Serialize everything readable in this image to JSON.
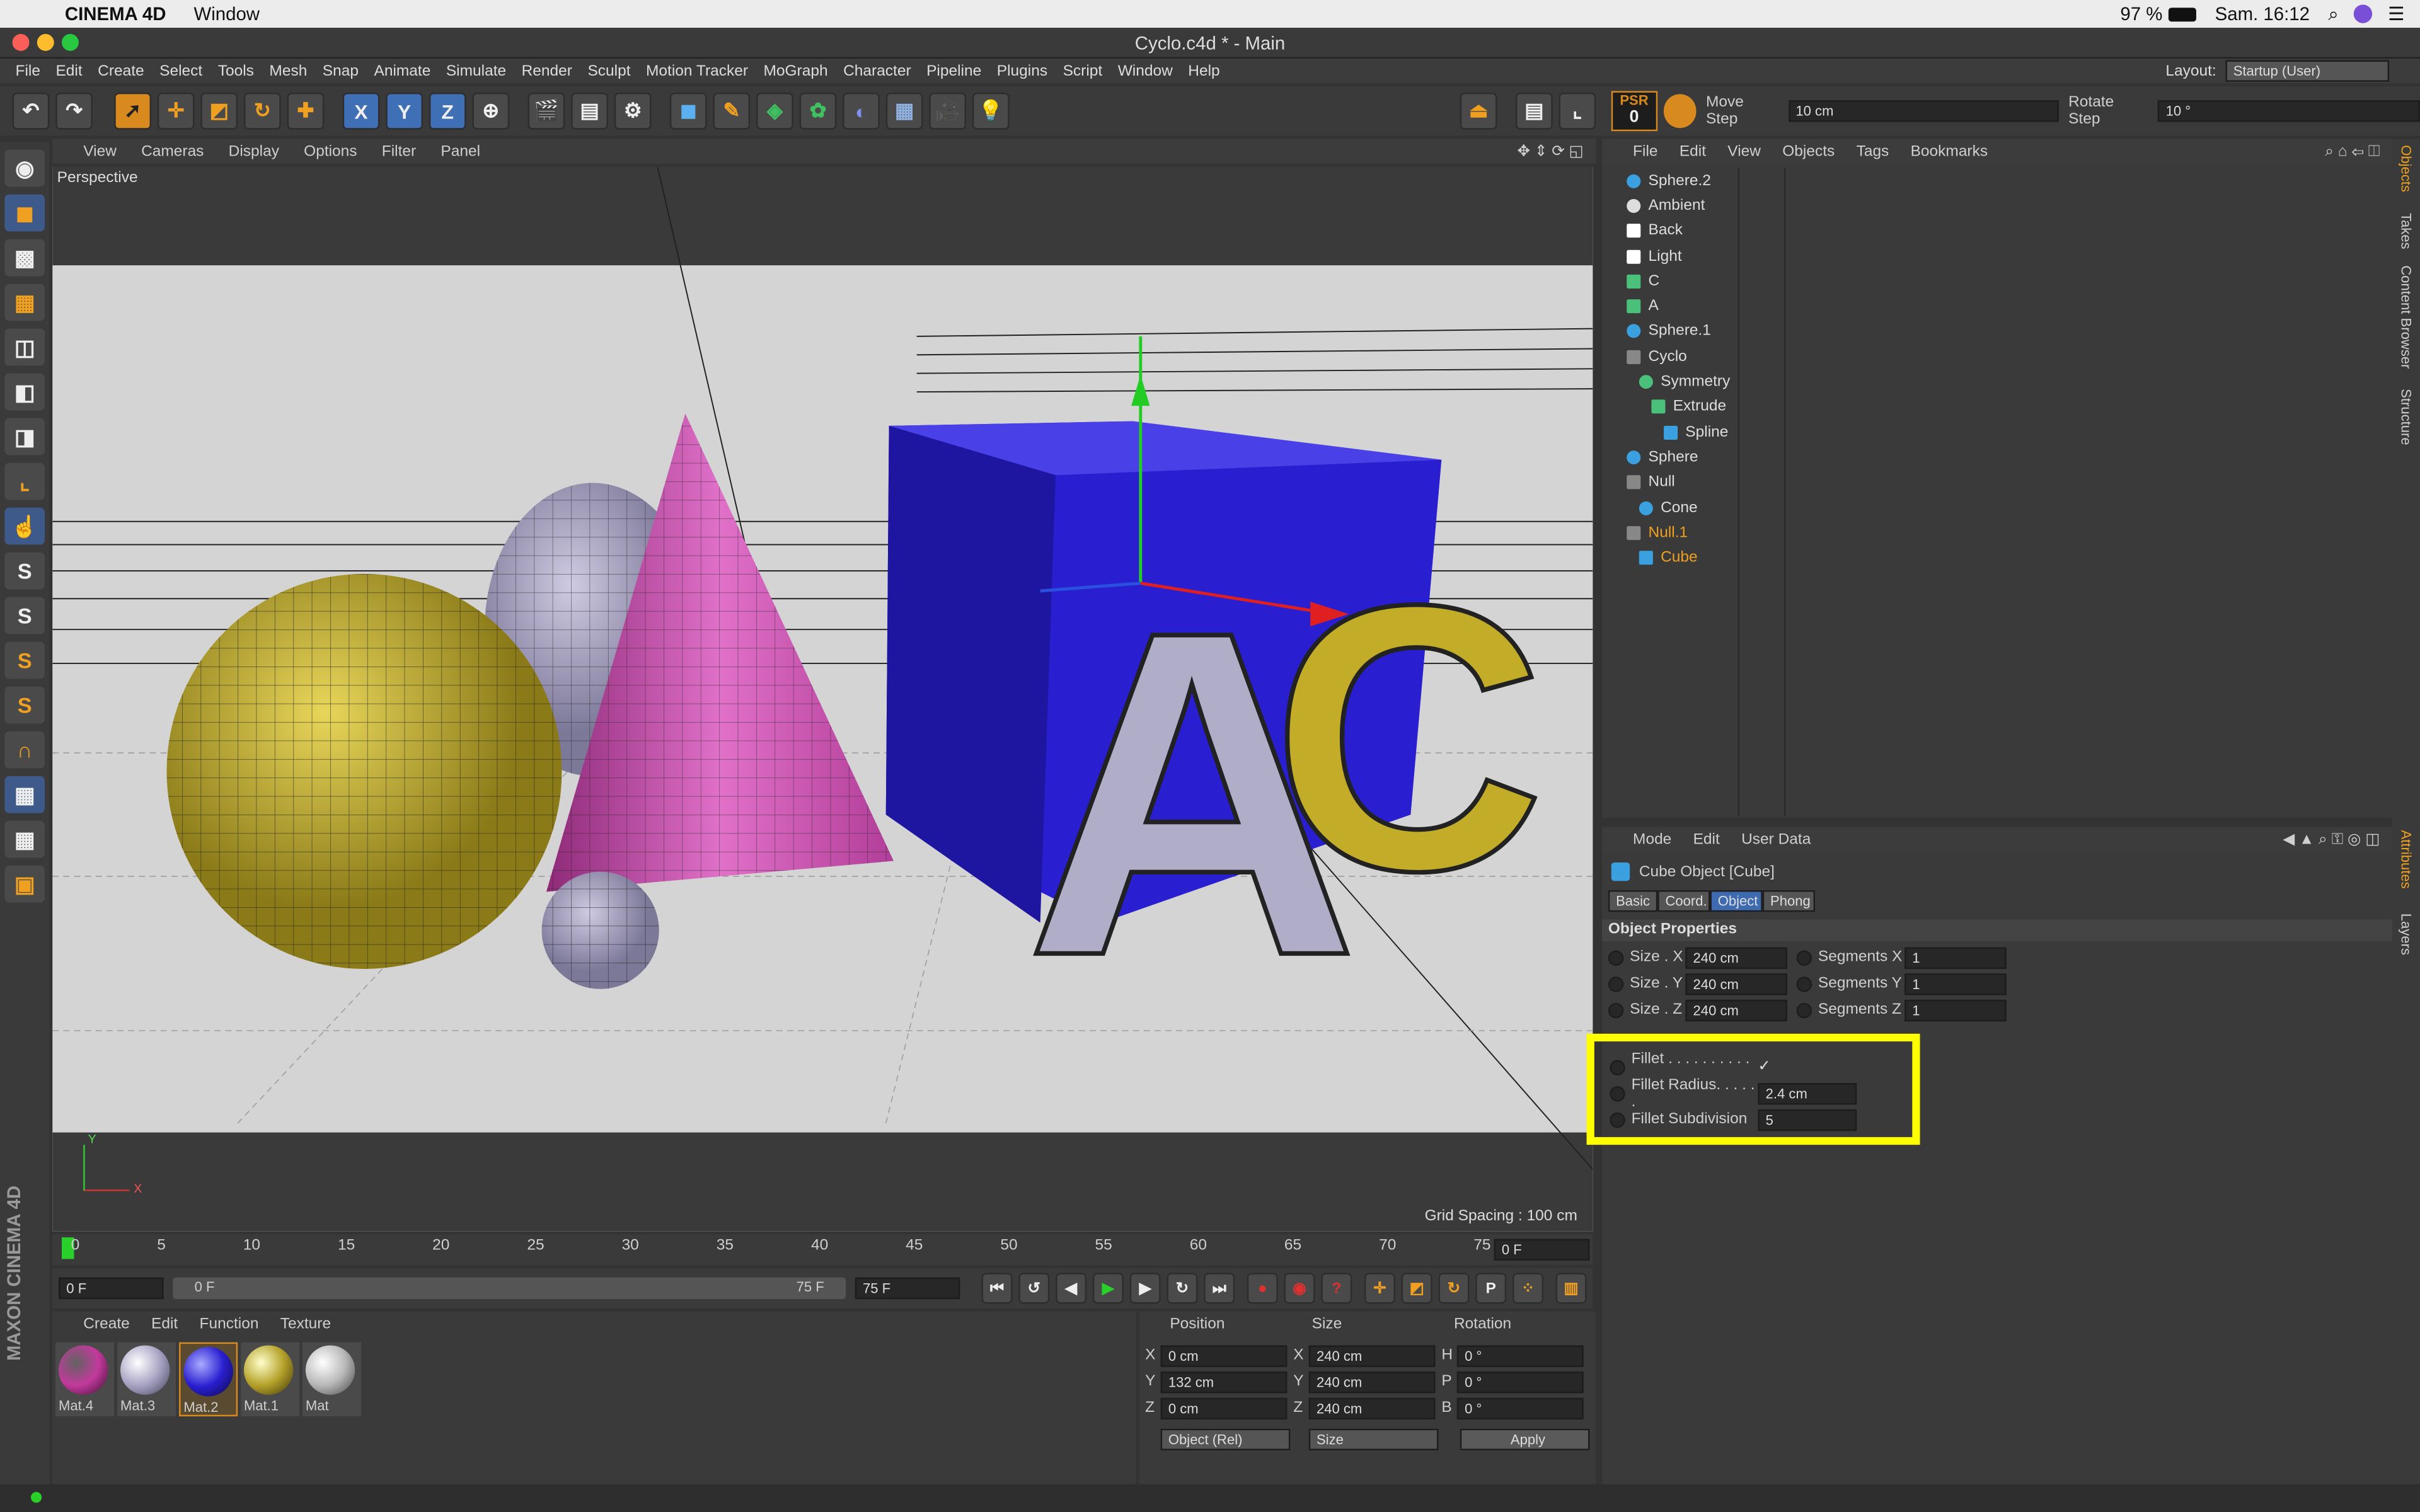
{
  "mac": {
    "app": "CINEMA 4D",
    "menu": "Window",
    "battery": "97 %",
    "clock": "Sam. 16:12"
  },
  "window": {
    "title": "Cyclo.c4d * - Main"
  },
  "menubar": [
    "File",
    "Edit",
    "Create",
    "Select",
    "Tools",
    "Mesh",
    "Snap",
    "Animate",
    "Simulate",
    "Render",
    "Sculpt",
    "Motion Tracker",
    "MoGraph",
    "Character",
    "Pipeline",
    "Plugins",
    "Script",
    "Window",
    "Help"
  ],
  "layout": {
    "label": "Layout:",
    "value": "Startup (User)"
  },
  "toolbar": {
    "axis_x": "X",
    "axis_y": "Y",
    "axis_z": "Z"
  },
  "psr": {
    "label": "PSR",
    "value": "0",
    "move_step_label": "Move Step",
    "move_step": "10 cm",
    "rotate_step_label": "Rotate Step",
    "rotate_step": "10 °"
  },
  "viewport": {
    "menu": [
      "View",
      "Cameras",
      "Display",
      "Options",
      "Filter",
      "Panel"
    ],
    "camera": "Perspective",
    "grid_spacing": "Grid Spacing : 100 cm",
    "axis_y": "Y",
    "axis_x": "X"
  },
  "timeline": {
    "ticks": [
      "0",
      "5",
      "10",
      "15",
      "20",
      "25",
      "30",
      "35",
      "40",
      "45",
      "50",
      "55",
      "60",
      "65",
      "70",
      "75"
    ],
    "current": "0 F"
  },
  "playbar": {
    "start": "0 F",
    "range_start": "0 F",
    "range_end": "75 F",
    "end": "75 F"
  },
  "materials": {
    "menu": [
      "Create",
      "Edit",
      "Function",
      "Texture"
    ],
    "items": [
      {
        "name": "Mat.4",
        "color": "#c23a9c"
      },
      {
        "name": "Mat.3",
        "color": "#a9a4c4"
      },
      {
        "name": "Mat.2",
        "color": "#2a1fd0"
      },
      {
        "name": "Mat.1",
        "color": "#b5a22a"
      },
      {
        "name": "Mat",
        "color": "#b8b8b8"
      }
    ]
  },
  "coords": {
    "headers": [
      "Position",
      "Size",
      "Rotation"
    ],
    "rows": [
      {
        "a": "X",
        "pos": "0 cm",
        "b": "X",
        "size": "240 cm",
        "c": "H",
        "rot": "0 °"
      },
      {
        "a": "Y",
        "pos": "132 cm",
        "b": "Y",
        "size": "240 cm",
        "c": "P",
        "rot": "0 °"
      },
      {
        "a": "Z",
        "pos": "0 cm",
        "b": "Z",
        "size": "240 cm",
        "c": "B",
        "rot": "0 °"
      }
    ],
    "mode": "Object (Rel)",
    "size_mode": "Size",
    "apply": "Apply"
  },
  "objects": {
    "menu": [
      "File",
      "Edit",
      "View",
      "Objects",
      "Tags",
      "Bookmarks"
    ],
    "items": [
      {
        "name": "Sphere.2",
        "color": "#3aa0e0",
        "tag": "#b0b0c0",
        "indent": 0
      },
      {
        "name": "Ambient",
        "color": "#dddddd",
        "tag": "",
        "indent": 0
      },
      {
        "name": "Back",
        "color": "#ffffff",
        "tag": "",
        "indent": 0
      },
      {
        "name": "Light",
        "color": "#ffffff",
        "tag": "",
        "indent": 0
      },
      {
        "name": "C",
        "color": "#4ac07a",
        "tag": "#c0b030",
        "indent": 0
      },
      {
        "name": "A",
        "color": "#4ac07a",
        "tag": "#b0b0c0",
        "indent": 0
      },
      {
        "name": "Sphere.1",
        "color": "#3aa0e0",
        "tag": "#c0b030",
        "indent": 0
      },
      {
        "name": "Cyclo",
        "color": "#888888",
        "tag": "#bbbbbb",
        "indent": 0
      },
      {
        "name": "Symmetry",
        "color": "#4ac07a",
        "tag": "",
        "indent": 1
      },
      {
        "name": "Extrude",
        "color": "#4ac07a",
        "tag": "",
        "indent": 2
      },
      {
        "name": "Spline",
        "color": "#3aa0e0",
        "tag": "",
        "indent": 3
      },
      {
        "name": "Sphere",
        "color": "#3aa0e0",
        "tag": "#b0b0c0",
        "indent": 0
      },
      {
        "name": "Null",
        "color": "#888888",
        "tag": "",
        "indent": 0
      },
      {
        "name": "Cone",
        "color": "#3aa0e0",
        "tag": "#c23a9c",
        "indent": 1
      },
      {
        "name": "Null.1",
        "color": "#888888",
        "tag": "",
        "indent": 0,
        "orange": true
      },
      {
        "name": "Cube",
        "color": "#3aa0e0",
        "tag": "#2a1fd0",
        "indent": 1,
        "orange": true
      }
    ]
  },
  "attributes": {
    "menu": [
      "Mode",
      "Edit",
      "User Data"
    ],
    "title": "Cube Object [Cube]",
    "tabs": [
      "Basic",
      "Coord.",
      "Object",
      "Phong"
    ],
    "section": "Object Properties",
    "sizes": [
      {
        "label": "Size . X",
        "value": "240 cm",
        "seg_label": "Segments X",
        "seg": "1"
      },
      {
        "label": "Size . Y",
        "value": "240 cm",
        "seg_label": "Segments Y",
        "seg": "1"
      },
      {
        "label": "Size . Z",
        "value": "240 cm",
        "seg_label": "Segments Z",
        "seg": "1"
      }
    ],
    "fillet_label": "Fillet . . . . . . . . . . . .",
    "fillet_check": "✓",
    "fillet_radius_label": "Fillet Radius. . . . . .",
    "fillet_radius": "2.4 cm",
    "fillet_sub_label": "Fillet Subdivision",
    "fillet_sub": "5"
  },
  "right_tabs": [
    "Objects",
    "Takes",
    "Content Browser",
    "Structure"
  ],
  "right_tabs2": [
    "Attributes",
    "Layers"
  ],
  "brand": "MAXON CINEMA 4D"
}
